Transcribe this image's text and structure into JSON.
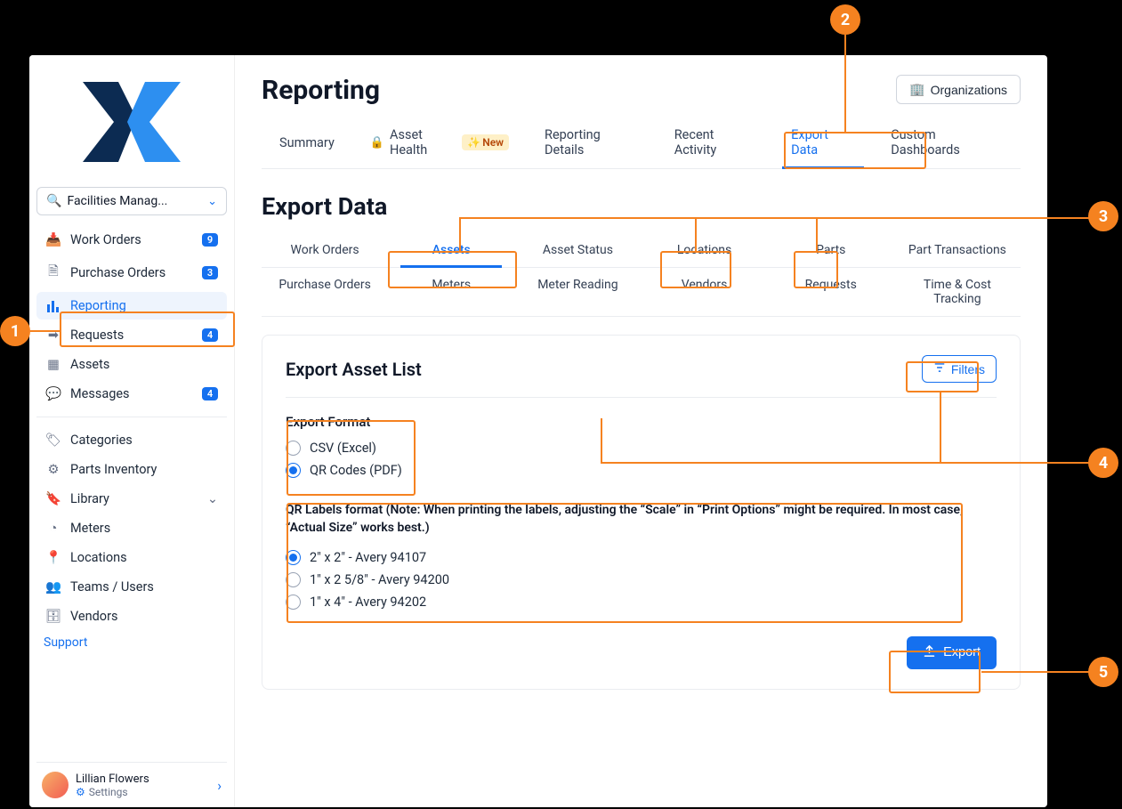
{
  "sidebar": {
    "facility": "Facilities Manag...",
    "nav1": [
      {
        "label": "Work Orders",
        "badge": "9",
        "icon": "📥"
      },
      {
        "label": "Purchase Orders",
        "badge": "3",
        "icon": "🗎"
      },
      {
        "label": "Reporting",
        "badge": null,
        "icon": "bar",
        "active": true
      },
      {
        "label": "Requests",
        "badge": "4",
        "icon": "➡"
      },
      {
        "label": "Assets",
        "badge": null,
        "icon": "▦"
      },
      {
        "label": "Messages",
        "badge": "4",
        "icon": "💬"
      }
    ],
    "nav2": [
      {
        "label": "Categories",
        "icon": "🏷"
      },
      {
        "label": "Parts Inventory",
        "icon": "⚙"
      },
      {
        "label": "Library",
        "icon": "🔖",
        "chev": true
      },
      {
        "label": "Meters",
        "icon": "◔"
      },
      {
        "label": "Locations",
        "icon": "📍"
      },
      {
        "label": "Teams / Users",
        "icon": "👥"
      },
      {
        "label": "Vendors",
        "icon": "🗄"
      }
    ],
    "support": "Support",
    "profile": {
      "name": "Lillian Flowers",
      "settings": "Settings"
    }
  },
  "header": {
    "title": "Reporting",
    "org_button": "Organizations",
    "tabs": [
      {
        "label": "Summary"
      },
      {
        "label": "Asset Health",
        "locked": true,
        "new": "New"
      },
      {
        "label": "Reporting Details"
      },
      {
        "label": "Recent Activity"
      },
      {
        "label": "Export Data",
        "active": true
      },
      {
        "label": "Custom Dashboards"
      }
    ]
  },
  "export": {
    "section_title": "Export Data",
    "subtabs_row1": [
      "Work Orders",
      "Assets",
      "Asset Status",
      "Locations",
      "Parts",
      "Part Transactions"
    ],
    "subtabs_active": "Assets",
    "subtabs_row2": [
      "Purchase Orders",
      "Meters",
      "Meter Reading",
      "Vendors",
      "Requests",
      "Time & Cost Tracking"
    ],
    "card_title": "Export Asset List",
    "filters_button": "Filters",
    "format_label": "Export Format",
    "format_options": [
      {
        "label": "CSV (Excel)",
        "checked": false
      },
      {
        "label": "QR Codes (PDF)",
        "checked": true
      }
    ],
    "qr_note": "QR Labels format (Note: When printing the labels, adjusting the “Scale” in “Print Options” might be required. In most case, “Actual Size” works best.)",
    "qr_options": [
      {
        "label": "2″ x 2″ - Avery 94107",
        "checked": true
      },
      {
        "label": "1″ x 2 5/8″ - Avery 94200",
        "checked": false
      },
      {
        "label": "1″ x 4″ - Avery 94202",
        "checked": false
      }
    ],
    "export_button": "Export"
  },
  "annotations": {
    "labels": [
      "1",
      "2",
      "3",
      "4",
      "5"
    ]
  }
}
